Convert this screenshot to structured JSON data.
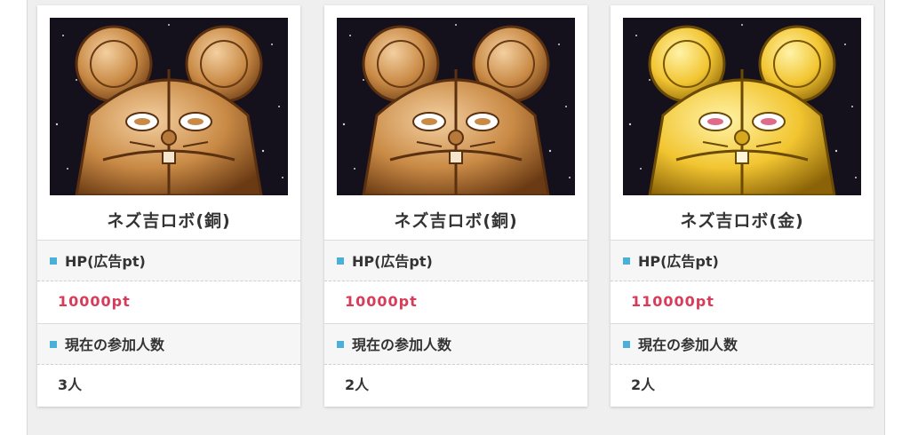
{
  "cards": [
    {
      "name": "ネズ吉ロボ(銅)",
      "variant": "bronze",
      "hp_label": "HP(広告pt)",
      "hp_value": "10000pt",
      "participants_label": "現在の参加人数",
      "participants_value": "3人"
    },
    {
      "name": "ネズ吉ロボ(銅)",
      "variant": "bronze",
      "hp_label": "HP(広告pt)",
      "hp_value": "10000pt",
      "participants_label": "現在の参加人数",
      "participants_value": "2人"
    },
    {
      "name": "ネズ吉ロボ(金)",
      "variant": "gold",
      "hp_label": "HP(広告pt)",
      "hp_value": "110000pt",
      "participants_label": "現在の参加人数",
      "participants_value": "2人"
    }
  ],
  "colors": {
    "accent_bullet": "#4ab0d9",
    "points_text": "#d73c5a",
    "bronze_body": "#c98a45",
    "gold_body": "#f2c531",
    "space_background": "#14101c"
  },
  "icons": [
    "square-bullet-icon"
  ]
}
